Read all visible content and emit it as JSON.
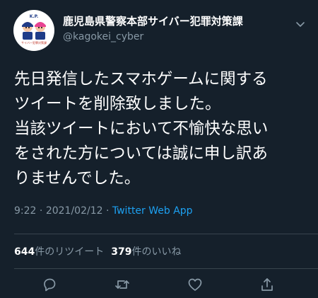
{
  "account": {
    "display_name": "鹿児島県警察本部サイバー犯罪対策課",
    "handle": "@kagokei_cyber",
    "avatar_top_text": "K.P.",
    "avatar_bottom_text": "サイバー犯罪対策課"
  },
  "tweet": {
    "lines": [
      "先日発信したスマホゲームに関する",
      "ツイートを削除致しました。",
      "当該ツイートにおいて不愉快な思い",
      "をされた方については誠に申し訳あ",
      "りませんでした。"
    ],
    "time": "9:22",
    "separator": "·",
    "date": "2021/02/12",
    "app": "Twitter Web App"
  },
  "stats": {
    "retweet_count": "644",
    "retweet_label": "件のリツイート",
    "like_count": "379",
    "like_label": "件のいいね"
  },
  "colors": {
    "background": "#15202b",
    "secondary_text": "#8899a6",
    "link": "#1da1f2",
    "divider": "#38444d"
  },
  "icons": {
    "reply": "reply-icon",
    "retweet": "retweet-icon",
    "like": "heart-icon",
    "share": "share-icon",
    "more": "chevron-down-icon"
  }
}
